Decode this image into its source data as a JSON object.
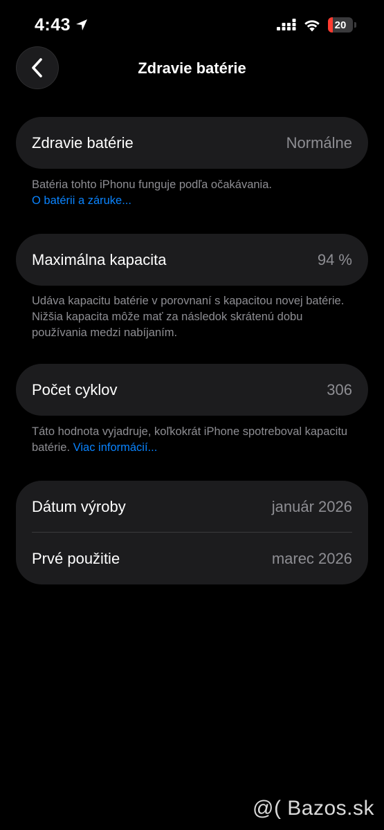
{
  "status_bar": {
    "time": "4:43",
    "battery_level": "20",
    "battery_fraction": 0.2,
    "icons": [
      "location-arrow-icon",
      "cellular-signal-icon",
      "wifi-icon",
      "battery-icon"
    ]
  },
  "nav": {
    "back_icon": "chevron-left-icon",
    "title": "Zdravie batérie"
  },
  "health": {
    "label": "Zdravie batérie",
    "value": "Normálne",
    "note": "Batéria tohto iPhonu funguje podľa očakávania.",
    "link": "O batérii a záruke..."
  },
  "capacity": {
    "label": "Maximálna kapacita",
    "value": "94 %",
    "note": "Udáva kapacitu batérie v porovnaní s kapacitou novej batérie. Nižšia kapacita môže mať za následok skrátenú dobu používania medzi nabíjaním."
  },
  "cycles": {
    "label": "Počet cyklov",
    "value": "306",
    "note": "Táto hodnota vyjadruje, koľkokrát iPhone spotreboval kapacitu batérie.",
    "link": "Viac informácií..."
  },
  "dates": {
    "manufacture_label": "Dátum výroby",
    "manufacture_value": "január 2026",
    "first_use_label": "Prvé použitie",
    "first_use_value": "marec 2026"
  },
  "watermark": "@( Bazos.sk",
  "colors": {
    "background": "#000000",
    "card": "#1c1c1e",
    "secondary_text": "#8e8e93",
    "link": "#0a84ff",
    "battery_low": "#ff3b30"
  }
}
